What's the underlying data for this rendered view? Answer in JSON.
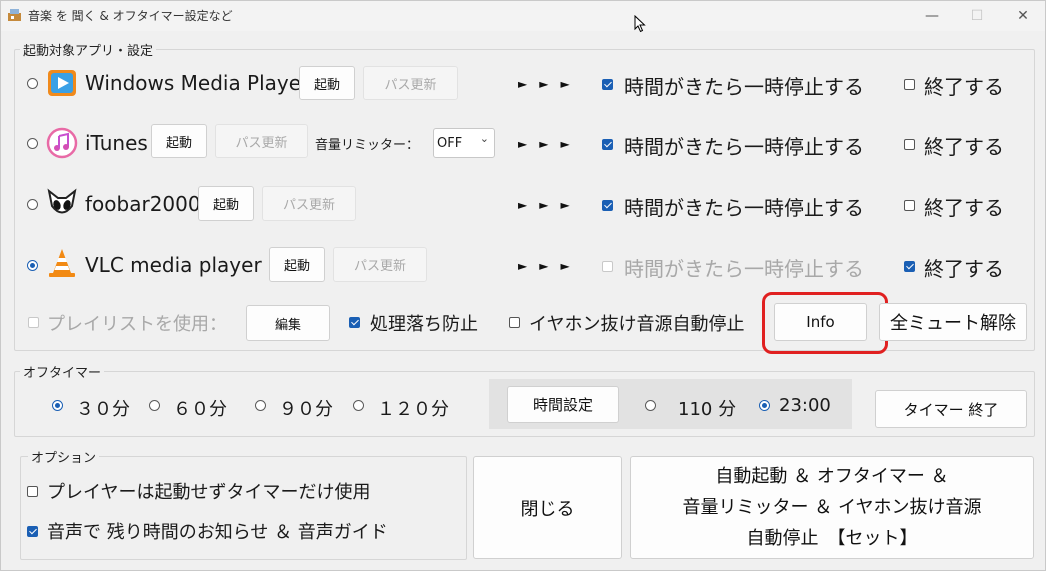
{
  "window": {
    "title": "音楽 を 聞く &  オフタイマー設定など",
    "controls": {
      "minimize": "—",
      "maximize": "☐",
      "close": "✕"
    }
  },
  "apps_group": {
    "legend": "起動対象アプリ・設定",
    "apps": [
      {
        "name": "Windows Media Player",
        "start": "起動",
        "path": "パス更新",
        "pause": "時間がきたら一時停止する",
        "quit": "終了する",
        "selected": false,
        "pause_checked": true,
        "quit_checked": false
      },
      {
        "name": "iTunes",
        "start": "起動",
        "path": "パス更新",
        "pause": "時間がきたら一時停止する",
        "quit": "終了する",
        "selected": false,
        "pause_checked": true,
        "quit_checked": false,
        "limiter_label": "音量リミッター：",
        "limiter_value": "OFF"
      },
      {
        "name": "foobar2000",
        "start": "起動",
        "path": "パス更新",
        "pause": "時間がきたら一時停止する",
        "quit": "終了する",
        "selected": false,
        "pause_checked": true,
        "quit_checked": false
      },
      {
        "name": "VLC media player",
        "start": "起動",
        "path": "パス更新",
        "pause": "時間がきたら一時停止する",
        "quit": "終了する",
        "selected": true,
        "pause_checked": false,
        "quit_checked": true
      }
    ],
    "arrows": "►►►",
    "playlist_label": "プレイリストを使用：",
    "edit_button": "編集",
    "prevent_drop": "処理落ち防止",
    "earphone_stop": "イヤホン抜け音源自動停止",
    "info_button": "Info",
    "unmute_button": "全ミュート解除"
  },
  "timer_group": {
    "legend": "オフタイマー",
    "options": [
      "３０分",
      "６０分",
      "９０分",
      "１２０分"
    ],
    "set_time_button": "時間設定",
    "custom_minutes": "110 分",
    "clock_time": "23:00",
    "end_button": "タイマー  終了"
  },
  "option_group": {
    "legend": "オプション",
    "timer_only": "プレイヤーは起動せずタイマーだけ使用",
    "voice_notice": "音声で 残り時間のお知らせ ＆ 音声ガイド"
  },
  "close_button": "閉じる",
  "set_button": {
    "line1": "自動起動 ＆ オフタイマー ＆",
    "line2": "音量リミッター ＆ イヤホン抜け音源",
    "line3": "自動停止　【セット】"
  },
  "colors": {
    "accent": "#1a5fb4",
    "highlight": "#e02020"
  }
}
